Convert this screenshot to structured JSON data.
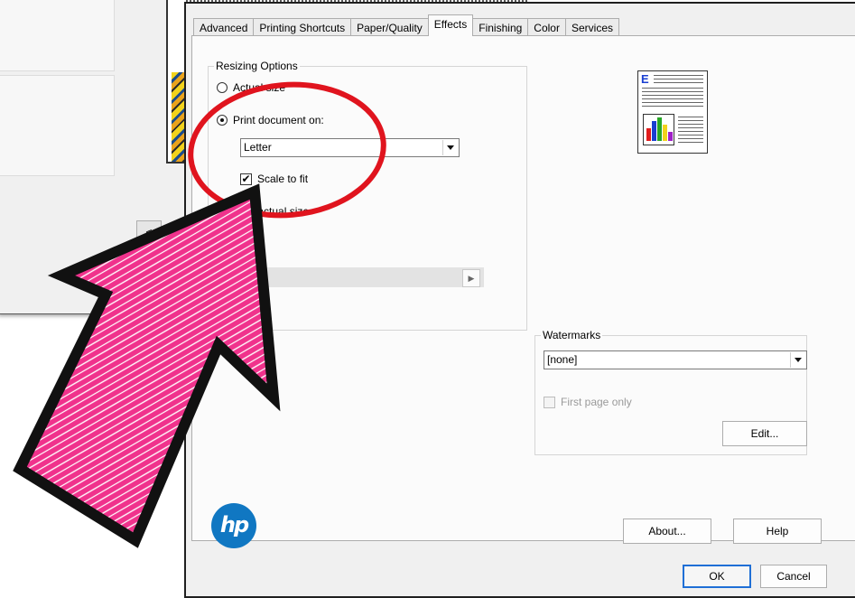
{
  "background_window": {
    "nav_button": "<"
  },
  "dialog": {
    "tabs": [
      {
        "label": "Advanced"
      },
      {
        "label": "Printing Shortcuts"
      },
      {
        "label": "Paper/Quality"
      },
      {
        "label": "Effects",
        "active": true
      },
      {
        "label": "Finishing"
      },
      {
        "label": "Color"
      },
      {
        "label": "Services"
      }
    ],
    "resizing": {
      "title": "Resizing Options",
      "actual_size_label": "Actual size",
      "print_document_on_label": "Print document on:",
      "paper_size_value": "Letter",
      "scale_to_fit_label": "Scale to fit",
      "percent_actual_size_label": "% of actual size"
    },
    "preview": {
      "letter": "E"
    },
    "watermarks": {
      "title": "Watermarks",
      "selected": "[none]",
      "first_page_only_label": "First page only",
      "edit_button": "Edit..."
    },
    "buttons": {
      "about": "About...",
      "help": "Help",
      "ok": "OK",
      "cancel": "Cancel"
    },
    "logo_text": "hp"
  },
  "annotation": {
    "circle_color": "#e0141e",
    "arrow_fill": "#f0328c",
    "arrow_outline": "#111111"
  }
}
